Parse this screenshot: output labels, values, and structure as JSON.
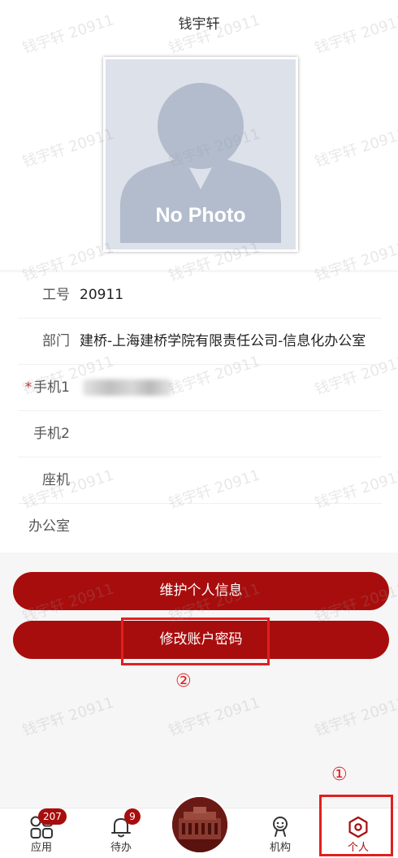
{
  "header": {
    "title": "钱宇轩"
  },
  "photo": {
    "placeholder_text": "No Photo"
  },
  "info": {
    "rows": [
      {
        "label": "工号",
        "value": "20911",
        "required": false
      },
      {
        "label": "部门",
        "value": "建桥-上海建桥学院有限责任公司-信息化办公室",
        "required": false
      },
      {
        "label": "手机1",
        "value": "",
        "required": true,
        "masked": true
      },
      {
        "label": "手机2",
        "value": "",
        "required": false
      },
      {
        "label": "座机",
        "value": "",
        "required": false
      },
      {
        "label": "办公室",
        "value": "",
        "required": false
      }
    ],
    "required_mark": "*"
  },
  "actions": {
    "maintain_label": "维护个人信息",
    "change_password_label": "修改账户密码"
  },
  "annotations": {
    "marker_1": "①",
    "marker_2": "②"
  },
  "watermark": {
    "text": "钱宇轩 20911"
  },
  "tabbar": {
    "tabs": [
      {
        "label": "应用",
        "icon": "apps-grid-icon",
        "badge": "207"
      },
      {
        "label": "待办",
        "icon": "bell-icon",
        "badge": "9"
      },
      {
        "label": "",
        "icon": "campus-logo-icon"
      },
      {
        "label": "机构",
        "icon": "organization-icon"
      },
      {
        "label": "个人",
        "icon": "hexagon-profile-icon",
        "active": true
      }
    ]
  },
  "colors": {
    "brand_red": "#a80d0d",
    "annotation_red": "#e02020"
  }
}
